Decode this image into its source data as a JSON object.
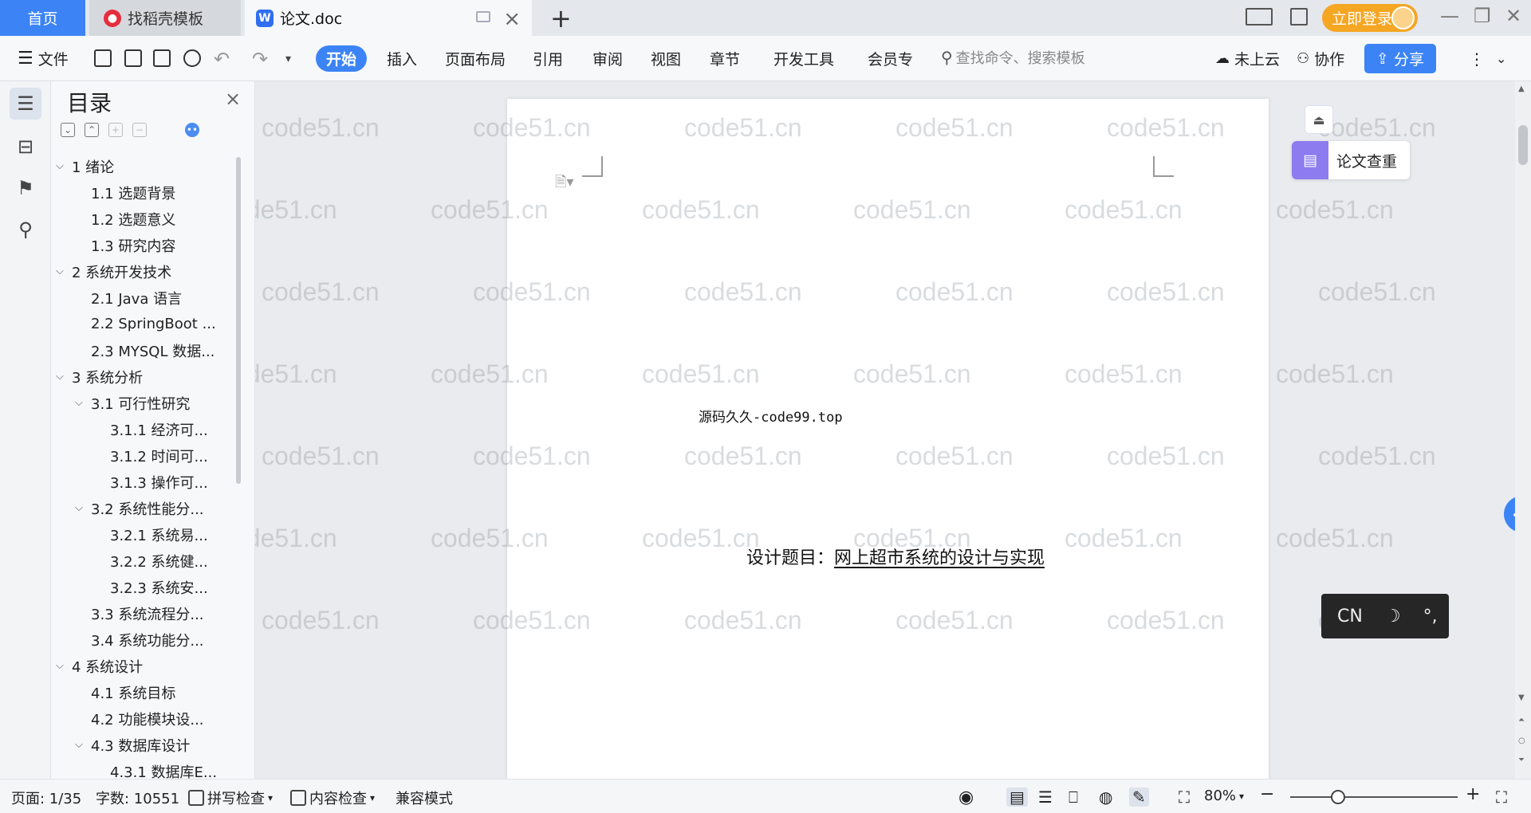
{
  "titlebar": {
    "tab_home": "首页",
    "tab_templates": "找稻壳模板",
    "tab_doc": "论文.doc",
    "new_tab": "+",
    "login": "立即登录"
  },
  "toolbar": {
    "file": "文件",
    "items": [
      "开始",
      "插入",
      "页面布局",
      "引用",
      "审阅",
      "视图",
      "章节",
      "开发工具",
      "会员专"
    ],
    "search_placeholder": "查找命令、搜索模板",
    "cloud": "未上云",
    "collab": "协作",
    "share": "分享"
  },
  "toc": {
    "title": "目录",
    "items": [
      {
        "label": "1  绪论",
        "level": 1,
        "expanded": true
      },
      {
        "label": "1.1  选题背景",
        "level": 2
      },
      {
        "label": "1.2  选题意义",
        "level": 2
      },
      {
        "label": "1.3  研究内容",
        "level": 2
      },
      {
        "label": "2  系统开发技术",
        "level": 1,
        "expanded": true
      },
      {
        "label": "2.1 Java 语言",
        "level": 2
      },
      {
        "label": "2.2 SpringBoot ...",
        "level": 2
      },
      {
        "label": "2.3 MYSQL 数据...",
        "level": 2
      },
      {
        "label": "3  系统分析",
        "level": 1,
        "expanded": true
      },
      {
        "label": "3.1 可行性研究",
        "level": 2,
        "expanded": true
      },
      {
        "label": "3.1.1 经济可...",
        "level": 3
      },
      {
        "label": "3.1.2 时间可...",
        "level": 3
      },
      {
        "label": "3.1.3 操作可...",
        "level": 3
      },
      {
        "label": "3.2 系统性能分...",
        "level": 2,
        "expanded": true
      },
      {
        "label": "3.2.1 系统易...",
        "level": 3
      },
      {
        "label": "3.2.2 系统健...",
        "level": 3
      },
      {
        "label": "3.2.3 系统安...",
        "level": 3
      },
      {
        "label": "3.3  系统流程分...",
        "level": 2
      },
      {
        "label": "3.4 系统功能分...",
        "level": 2
      },
      {
        "label": "4  系统设计",
        "level": 1,
        "expanded": true
      },
      {
        "label": "4.1 系统目标",
        "level": 2
      },
      {
        "label": "4.2 功能模块设...",
        "level": 2
      },
      {
        "label": "4.3 数据库设计",
        "level": 2,
        "expanded": true
      },
      {
        "label": "4.3.1 数据库E...",
        "level": 3
      }
    ]
  },
  "document": {
    "line1": "源码久久-code99.top",
    "title_prefix": "设计题目：",
    "title_main": "网上超市系统的设计与实现",
    "watermark": "code51.cn"
  },
  "side": {
    "check": "论文查重",
    "ime_lang": "CN",
    "ime_moon": "☽",
    "ime_punct": "°,"
  },
  "status": {
    "page": "页面: 1/35",
    "words": "字数: 10551",
    "spell": "拼写检查",
    "content": "内容检查",
    "compat": "兼容模式",
    "zoom": "80%",
    "zoom_value": 0.3
  }
}
